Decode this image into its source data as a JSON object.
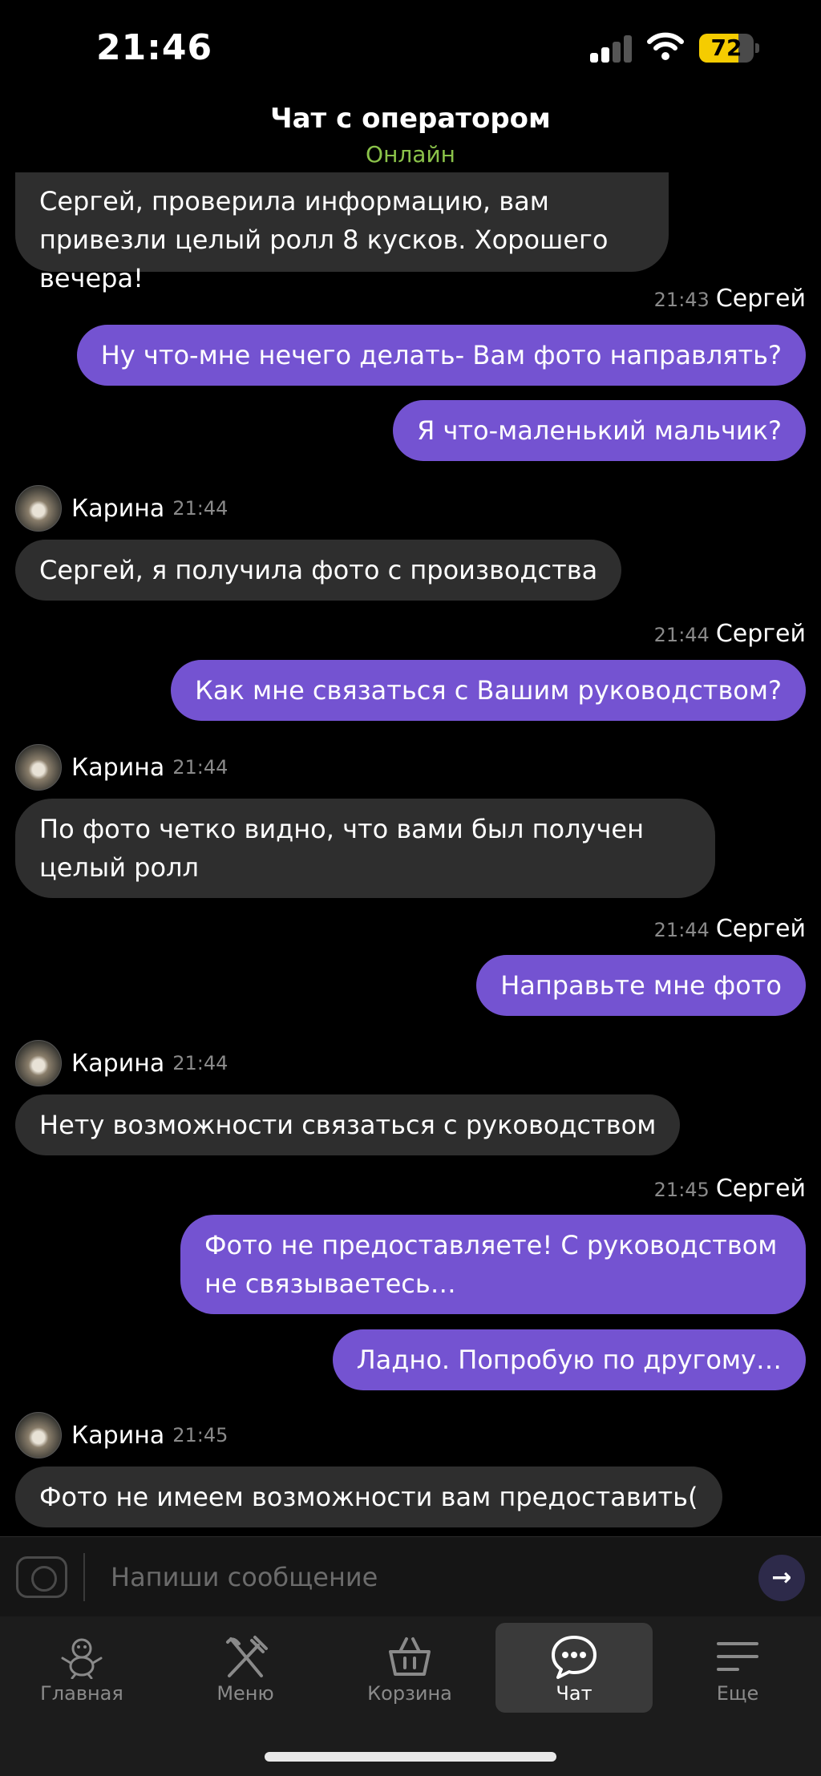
{
  "status_bar": {
    "time": "21:46",
    "battery": "72",
    "battery_level": 0.72
  },
  "header": {
    "title": "Чат с оператором",
    "status": "Онлайн"
  },
  "colors": {
    "accent": "#7453d1",
    "incoming_bubble": "#2e2e2e",
    "online": "#8bc34a"
  },
  "messages": [
    {
      "text": "Сергей, проверила информацию, вам привезли целый ролл 8 кусков. Хорошего вечера!"
    },
    {
      "time": "21:43",
      "author": "Сергей",
      "text": "Ну что-мне нечего делать- Вам фото направлять?"
    },
    {
      "text": "Я что-маленький мальчик?"
    },
    {
      "author": "Карина",
      "time": "21:44",
      "text": "Сергей, я получила фото с производства"
    },
    {
      "time": "21:44",
      "author": "Сергей",
      "text": "Как мне связаться с Вашим руководством?"
    },
    {
      "author": "Карина",
      "time": "21:44",
      "text": "По фото четко видно, что вами был получен целый ролл"
    },
    {
      "time": "21:44",
      "author": "Сергей",
      "text": "Направьте мне фото"
    },
    {
      "author": "Карина",
      "time": "21:44",
      "text": "Нету возможности связаться с руководством"
    },
    {
      "time": "21:45",
      "author": "Сергей",
      "text": "Фото не предоставляете! С руководством не связываетесь…"
    },
    {
      "text": "Ладно. Попробую по другому…"
    },
    {
      "author": "Карина",
      "time": "21:45",
      "text": "Фото не имеем возможности вам предоставить("
    }
  ],
  "input": {
    "placeholder": "Напиши сообщение",
    "send_icon": "arrow-right-icon",
    "attach_icon": "camera-icon"
  },
  "tabs": [
    {
      "label": "Главная",
      "icon": "mascot-icon"
    },
    {
      "label": "Меню",
      "icon": "fork-knife-icon"
    },
    {
      "label": "Корзина",
      "icon": "basket-icon"
    },
    {
      "label": "Чат",
      "icon": "chat-bubble-icon",
      "active": true
    },
    {
      "label": "Еще",
      "icon": "menu-lines-icon"
    }
  ]
}
